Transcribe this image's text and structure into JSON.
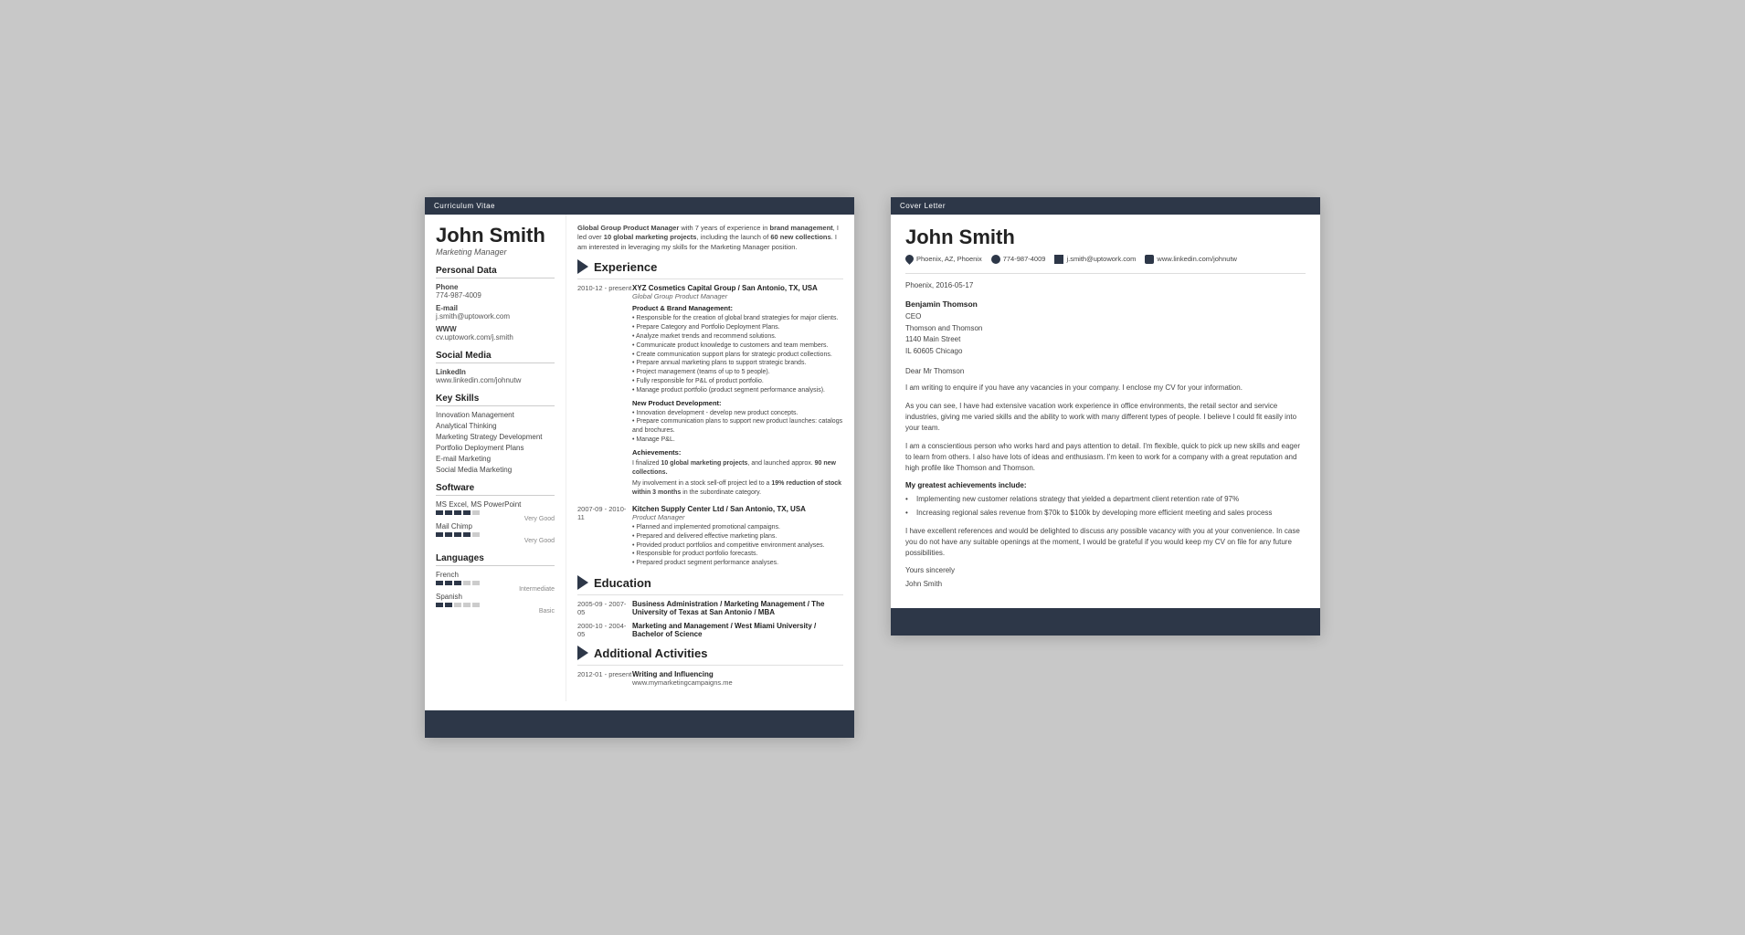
{
  "cv": {
    "header_bar": "Curriculum Vitae",
    "name": "John Smith",
    "title": "Marketing Manager",
    "intro": "Global Group Product Manager with 7 years of experience in brand management, I led over 10 global marketing projects, including the launch of 60 new collections. I am interested in leveraging my skills for the Marketing Manager position.",
    "personal_data": {
      "section": "Personal Data",
      "phone_label": "Phone",
      "phone": "774-987-4009",
      "email_label": "E-mail",
      "email": "j.smith@uptowork.com",
      "www_label": "WWW",
      "www": "cv.uptowork.com/j.smith"
    },
    "social_media": {
      "section": "Social Media",
      "linkedin_label": "LinkedIn",
      "linkedin": "www.linkedin.com/johnutw"
    },
    "key_skills": {
      "section": "Key Skills",
      "items": [
        "Innovation Management",
        "Analytical Thinking",
        "Marketing Strategy Development",
        "Portfolio Deployment Plans",
        "E-mail Marketing",
        "Social Media Marketing"
      ]
    },
    "software": {
      "section": "Software",
      "items": [
        {
          "name": "MS Excel, MS PowerPoint",
          "rating": 4,
          "max": 5,
          "label": "Very Good"
        },
        {
          "name": "Mail Chimp",
          "rating": 4,
          "max": 5,
          "label": "Very Good"
        }
      ]
    },
    "languages": {
      "section": "Languages",
      "items": [
        {
          "name": "French",
          "rating": 3,
          "max": 5,
          "label": "Intermediate"
        },
        {
          "name": "Spanish",
          "rating": 2,
          "max": 5,
          "label": "Basic"
        }
      ]
    },
    "experience": {
      "section": "Experience",
      "entries": [
        {
          "date": "2010-12 - present",
          "company": "XYZ Cosmetics Capital Group / San Antonio, TX, USA",
          "role": "Global Group Product Manager",
          "sub_sections": [
            {
              "title": "Product & Brand Management:",
              "bullets": [
                "Responsible for the creation of global brand strategies for major clients.",
                "Prepare Category and Portfolio Deployment Plans.",
                "Analyze market trends and recommend solutions.",
                "Communicate product knowledge to customers and team members.",
                "Create communication support plans for strategic product collections.",
                "Prepare annual marketing plans to support strategic brands.",
                "Project management (teams of up to 5 people).",
                "Fully responsible for P&L of product portfolio.",
                "Manage product portfolio (product segment performance analysis)."
              ]
            },
            {
              "title": "New Product Development:",
              "bullets": [
                "Innovation development - develop new product concepts.",
                "Prepare communication plans to support new product launches: catalogs and brochures.",
                "Manage P&L."
              ]
            },
            {
              "title": "Achievements:",
              "achievements": [
                "I finalized 10 global marketing projects, and launched approx. 90 new collections.",
                "My involvement in a stock sell-off project led to a 19% reduction of stock within 3 months in the subordinate category."
              ]
            }
          ]
        },
        {
          "date": "2007-09 - 2010-11",
          "company": "Kitchen Supply Center Ltd / San Antonio, TX, USA",
          "role": "Product Manager",
          "bullets": [
            "Planned and implemented promotional campaigns.",
            "Prepared and delivered effective marketing plans.",
            "Provided product portfolios and competitive environment analyses.",
            "Responsible for product portfolio forecasts.",
            "Prepared product segment performance analyses."
          ]
        }
      ]
    },
    "education": {
      "section": "Education",
      "entries": [
        {
          "date": "2005-09 - 2007-05",
          "degree": "Business Administration / Marketing Management / The University of Texas at San Antonio / MBA"
        },
        {
          "date": "2000-10 - 2004-05",
          "degree": "Marketing and Management / West Miami University / Bachelor of Science"
        }
      ]
    },
    "additional": {
      "section": "Additional Activities",
      "entries": [
        {
          "date": "2012-01 - present",
          "title": "Writing and Influencing",
          "detail": "www.mymarketingcampaigns.me"
        }
      ]
    }
  },
  "cover_letter": {
    "header_bar": "Cover Letter",
    "name": "John Smith",
    "contact": {
      "location": "Phoenix, AZ, Phoenix",
      "phone": "774-987-4009",
      "email": "j.smith@uptowork.com",
      "linkedin": "www.linkedin.com/johnutw"
    },
    "date": "Phoenix, 2016-05-17",
    "recipient": {
      "name": "Benjamin Thomson",
      "title": "CEO",
      "company": "Thomson and Thomson",
      "address": "1140 Main Street",
      "city": "IL 60605 Chicago"
    },
    "salutation": "Dear Mr Thomson",
    "paragraphs": [
      "I am writing to enquire if you have any vacancies in your company. I enclose my CV for your information.",
      "As you can see, I have had extensive vacation work experience in office environments, the retail sector and service industries, giving me varied skills and the ability to work with many different types of people. I believe I could fit easily into your team.",
      "I am a conscientious person who works hard and pays attention to detail. I'm flexible, quick to pick up new skills and eager to learn from others. I also have lots of ideas and enthusiasm. I'm keen to work for a company with a great reputation and high profile like Thomson and Thomson."
    ],
    "achievements_title": "My greatest achievements include:",
    "achievements": [
      "Implementing new customer relations strategy that yielded a department client retention rate of 97%",
      "Increasing regional sales revenue from $70k to $100k by developing more efficient meeting and sales process"
    ],
    "closing_para": "I have excellent references and would be delighted to discuss any possible vacancy with you at your convenience. In case you do not have any suitable openings at the moment, I would be grateful if you would keep my CV on file for any future possibilities.",
    "valediction": "Yours sincerely",
    "signature": "John Smith"
  }
}
